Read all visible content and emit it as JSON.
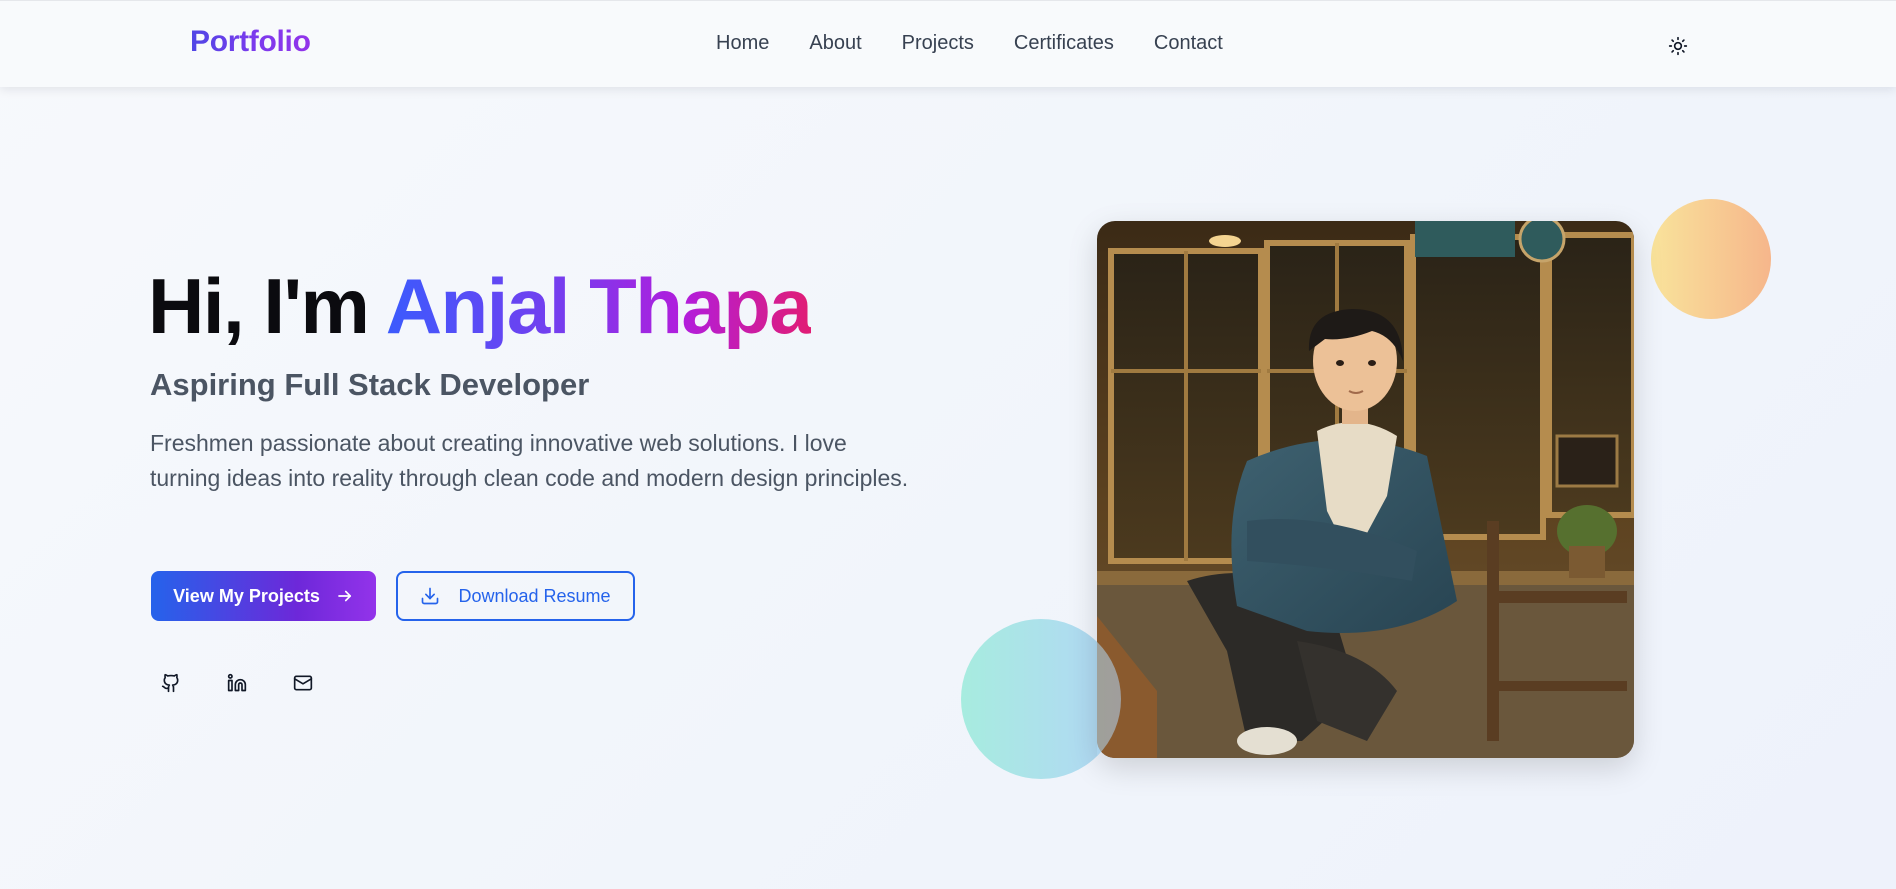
{
  "nav": {
    "brand": "Portfolio",
    "links": [
      "Home",
      "About",
      "Projects",
      "Certificates",
      "Contact"
    ],
    "theme_icon": "sun-icon"
  },
  "hero": {
    "greeting": "Hi, I'm ",
    "name": "Anjal Thapa",
    "subtitle": "Aspiring Full Stack Developer",
    "description": "Freshmen passionate about creating innovative web solutions. I love turning ideas into reality through clean code and modern design principles.",
    "primary_button": "View My Projects",
    "secondary_button": "Download Resume",
    "social_icons": [
      "github-icon",
      "linkedin-icon",
      "mail-icon"
    ]
  },
  "colors": {
    "accent_blue": "#2563eb",
    "accent_purple": "#9333ea",
    "name_gradient_end": "#e11d74",
    "text_muted": "#4b5563"
  }
}
